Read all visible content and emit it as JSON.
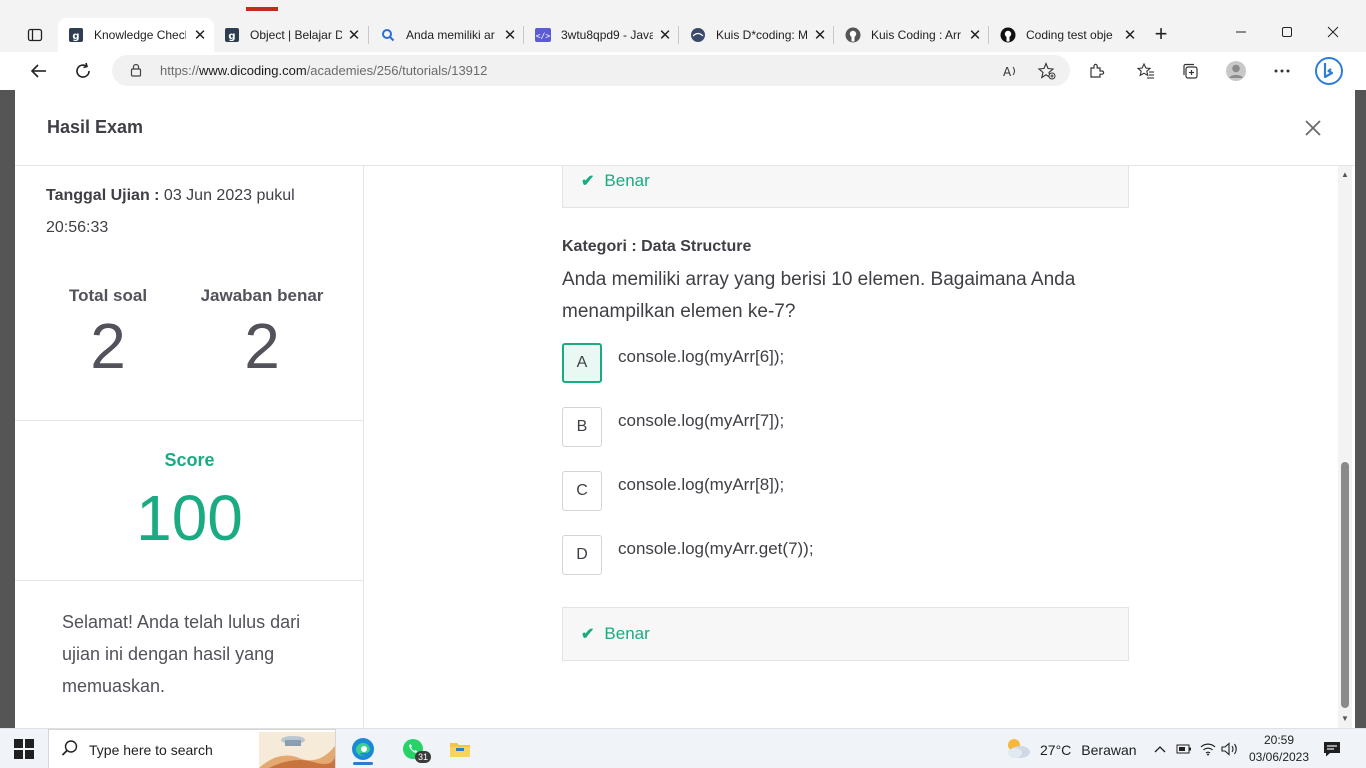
{
  "browser": {
    "tabs": [
      {
        "title": "Knowledge Check",
        "icon": "dicoding-favicon",
        "active": true
      },
      {
        "title": "Object | Belajar D",
        "icon": "dicoding-favicon",
        "active": false
      },
      {
        "title": "Anda memiliki ar",
        "icon": "search-favicon",
        "active": false
      },
      {
        "title": "3wtu8qpd9 - Java",
        "icon": "code-favicon",
        "active": false
      },
      {
        "title": "Kuis D*coding: M",
        "icon": "globe-favicon",
        "active": false
      },
      {
        "title": "Kuis Coding : Arr",
        "icon": "github-favicon",
        "active": false
      },
      {
        "title": "Coding test obje",
        "icon": "github-favicon",
        "active": false
      }
    ],
    "url_scheme": "https://",
    "url_host": "www.dicoding.com",
    "url_path": "/academies/256/tutorials/13912"
  },
  "modal": {
    "title": "Hasil Exam",
    "exam_date_label": "Tanggal Ujian :",
    "exam_date_value": " 03 Jun 2023 pukul 20:56:33",
    "total_soal_label": "Total soal",
    "total_soal_value": "2",
    "jawaban_benar_label": "Jawaban benar",
    "jawaban_benar_value": "2",
    "score_label": "Score",
    "score_value": "100",
    "congrats": "Selamat! Anda telah lulus dari ujian ini dengan hasil yang memuaskan."
  },
  "content": {
    "prev_result": "Benar",
    "category": "Kategori : Data Structure",
    "question": "Anda memiliki array yang berisi 10 elemen. Bagaimana Anda menampilkan elemen ke-7?",
    "options": [
      {
        "letter": "A",
        "text": "console.log(myArr[6]);",
        "selected": true
      },
      {
        "letter": "B",
        "text": "console.log(myArr[7]);",
        "selected": false
      },
      {
        "letter": "C",
        "text": "console.log(myArr[8]);",
        "selected": false
      },
      {
        "letter": "D",
        "text": "console.log(myArr.get(7));",
        "selected": false
      }
    ],
    "result": "Benar"
  },
  "taskbar": {
    "search_placeholder": "Type here to search",
    "whatsapp_badge": "31",
    "temperature": "27°C",
    "weather_condition": "Berawan",
    "time": "20:59",
    "date": "03/06/2023"
  },
  "colors": {
    "accent": "#1aab82",
    "text": "#3f3f46"
  }
}
